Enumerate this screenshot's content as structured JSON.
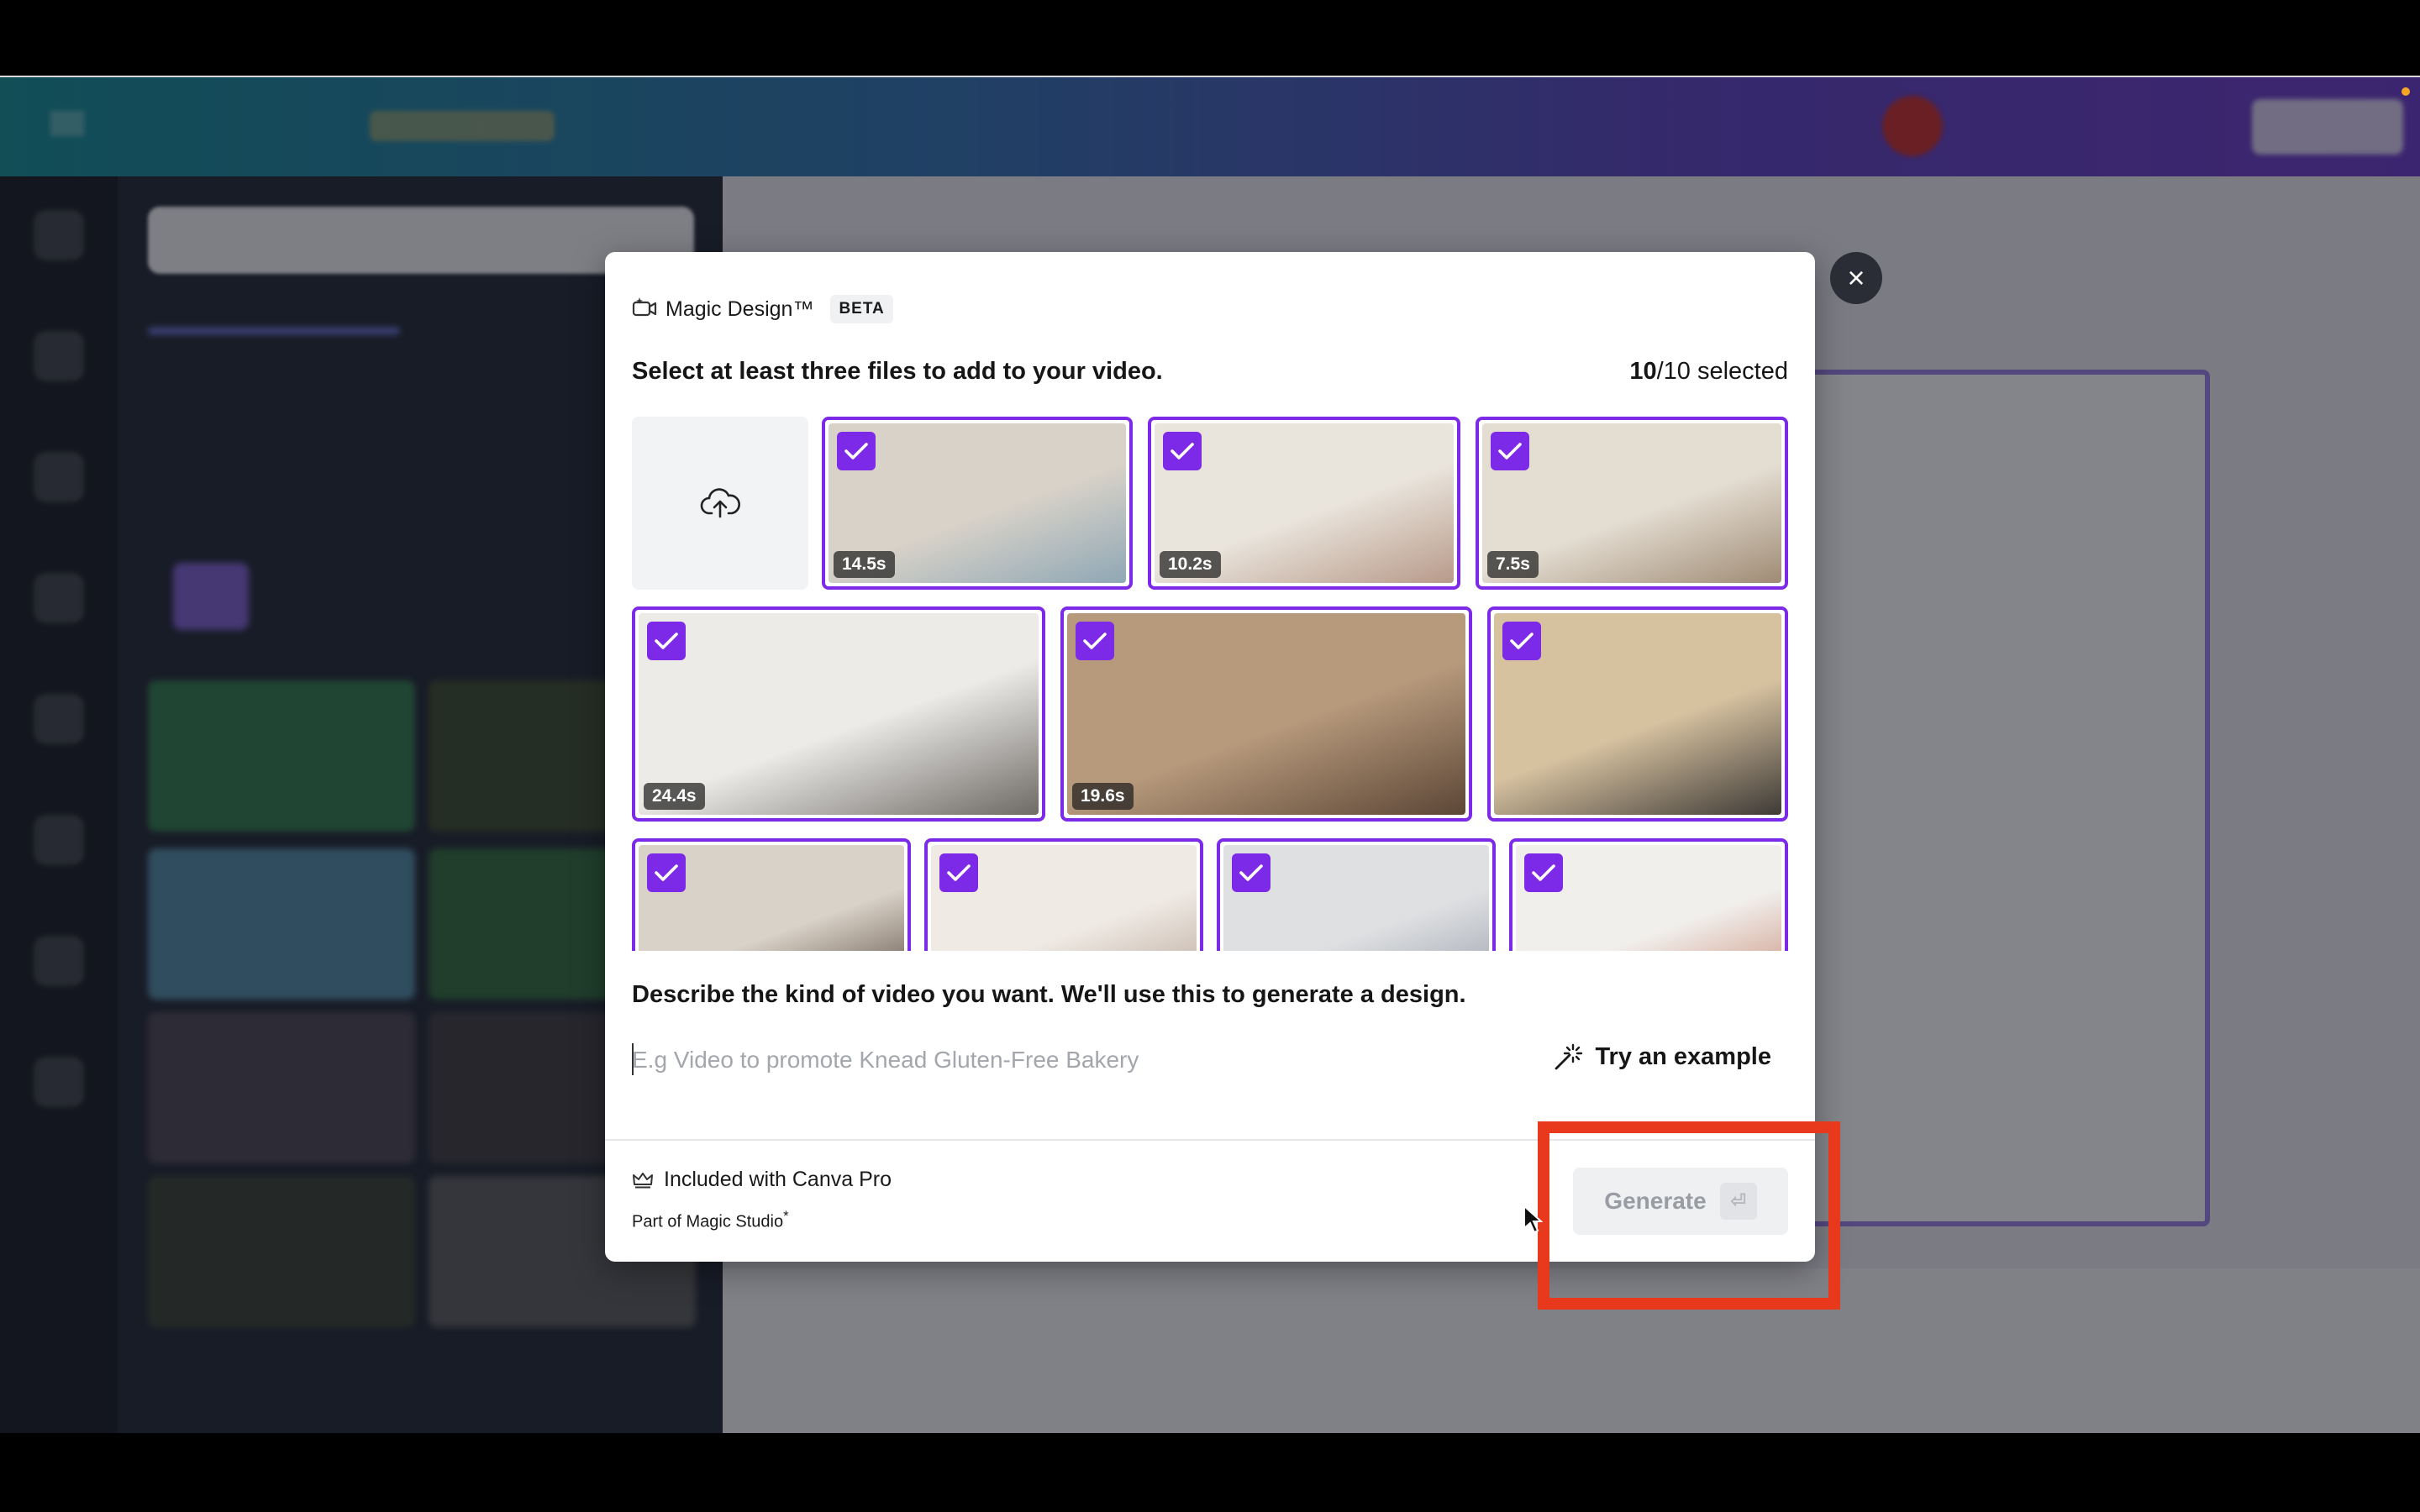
{
  "modal": {
    "title": "Magic Design™",
    "badge": "BETA",
    "instruction": "Select at least three files to add to your video.",
    "selected_count": "10",
    "selected_total": "/10 selected",
    "describe_label": "Describe the kind of video you want. We'll use this to generate a design.",
    "prompt_placeholder": "E.g Video to promote Knead Gluten-Free Bakery",
    "prompt_value": "",
    "try_example": "Try an example",
    "included": "Included with Canva Pro",
    "part_of": "Part of Magic Studio",
    "part_of_mark": "*",
    "generate": "Generate",
    "close_icon": "×"
  },
  "media": [
    {
      "duration": "14.5s",
      "selected": true,
      "color_a": "#d8d2c8",
      "color_b": "#8fa7b5"
    },
    {
      "duration": "10.2s",
      "selected": true,
      "color_a": "#e9e4dc",
      "color_b": "#b89a8a"
    },
    {
      "duration": "7.5s",
      "selected": true,
      "color_a": "#e4ddd2",
      "color_b": "#9f8b74"
    },
    {
      "duration": "24.4s",
      "selected": true,
      "color_a": "#ecebe8",
      "color_b": "#6e6a66"
    },
    {
      "duration": "19.6s",
      "selected": true,
      "color_a": "#b79a7c",
      "color_b": "#5c4636"
    },
    {
      "duration": "",
      "selected": true,
      "color_a": "#d7c2a0",
      "color_b": "#3e3a36"
    },
    {
      "duration": "",
      "selected": true,
      "color_a": "#d9d2c8",
      "color_b": "#5a4a3e"
    },
    {
      "duration": "",
      "selected": true,
      "color_a": "#efeae4",
      "color_b": "#b9a69a"
    },
    {
      "duration": "",
      "selected": true,
      "color_a": "#dfe0e2",
      "color_b": "#9aa2ac"
    },
    {
      "duration": "",
      "selected": true,
      "color_a": "#f1efec",
      "color_b": "#c98e7a"
    }
  ],
  "colors": {
    "accent": "#7d2ae8",
    "highlight": "#e8391d"
  }
}
